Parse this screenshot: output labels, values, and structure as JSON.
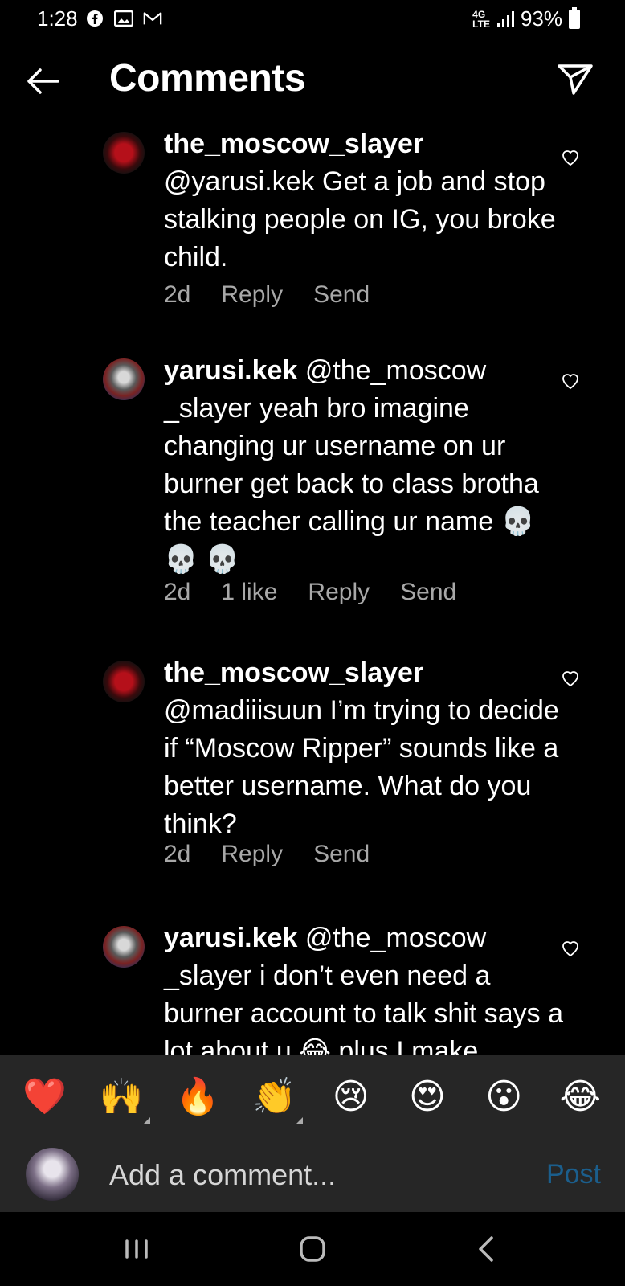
{
  "status_bar": {
    "time": "1:28",
    "network": "4G LTE",
    "battery": "93%"
  },
  "header": {
    "title": "Comments"
  },
  "comments": [
    {
      "username": "the_moscow_slayer",
      "text": "@yarusi.kek Get a job and stop stalking people on IG, you broke child.",
      "time": "2d",
      "likes": "",
      "reply_label": "Reply",
      "send_label": "Send"
    },
    {
      "username": "yarusi.kek",
      "text": "@the_moscow _slayer yeah bro imagine changing ur username on ur burner get back to class brotha the teacher calling ur name 💀 💀 💀",
      "time": "2d",
      "likes": "1 like",
      "reply_label": "Reply",
      "send_label": "Send"
    },
    {
      "username": "the_moscow_slayer",
      "text": "@madiiisuun I’m trying to decide if “Moscow Ripper” sounds like a better username. What do you think?",
      "time": "2d",
      "likes": "",
      "reply_label": "Reply",
      "send_label": "Send"
    },
    {
      "username": "yarusi.kek",
      "text": "@the_moscow _slayer i don’t even need a burner account to talk shit says a lot about u 😂 plus I make",
      "time": "",
      "likes": "",
      "reply_label": "",
      "send_label": ""
    }
  ],
  "emoji_bar": [
    "❤️",
    "🙌",
    "🔥",
    "👏",
    "😢",
    "😍",
    "😮",
    "😂"
  ],
  "comment_input": {
    "placeholder": "Add a comment...",
    "post_label": "Post"
  },
  "colors": {
    "background": "#000000",
    "panel": "#262626",
    "meta_text": "#a8a8a8",
    "post_disabled": "#1b5e8c"
  }
}
